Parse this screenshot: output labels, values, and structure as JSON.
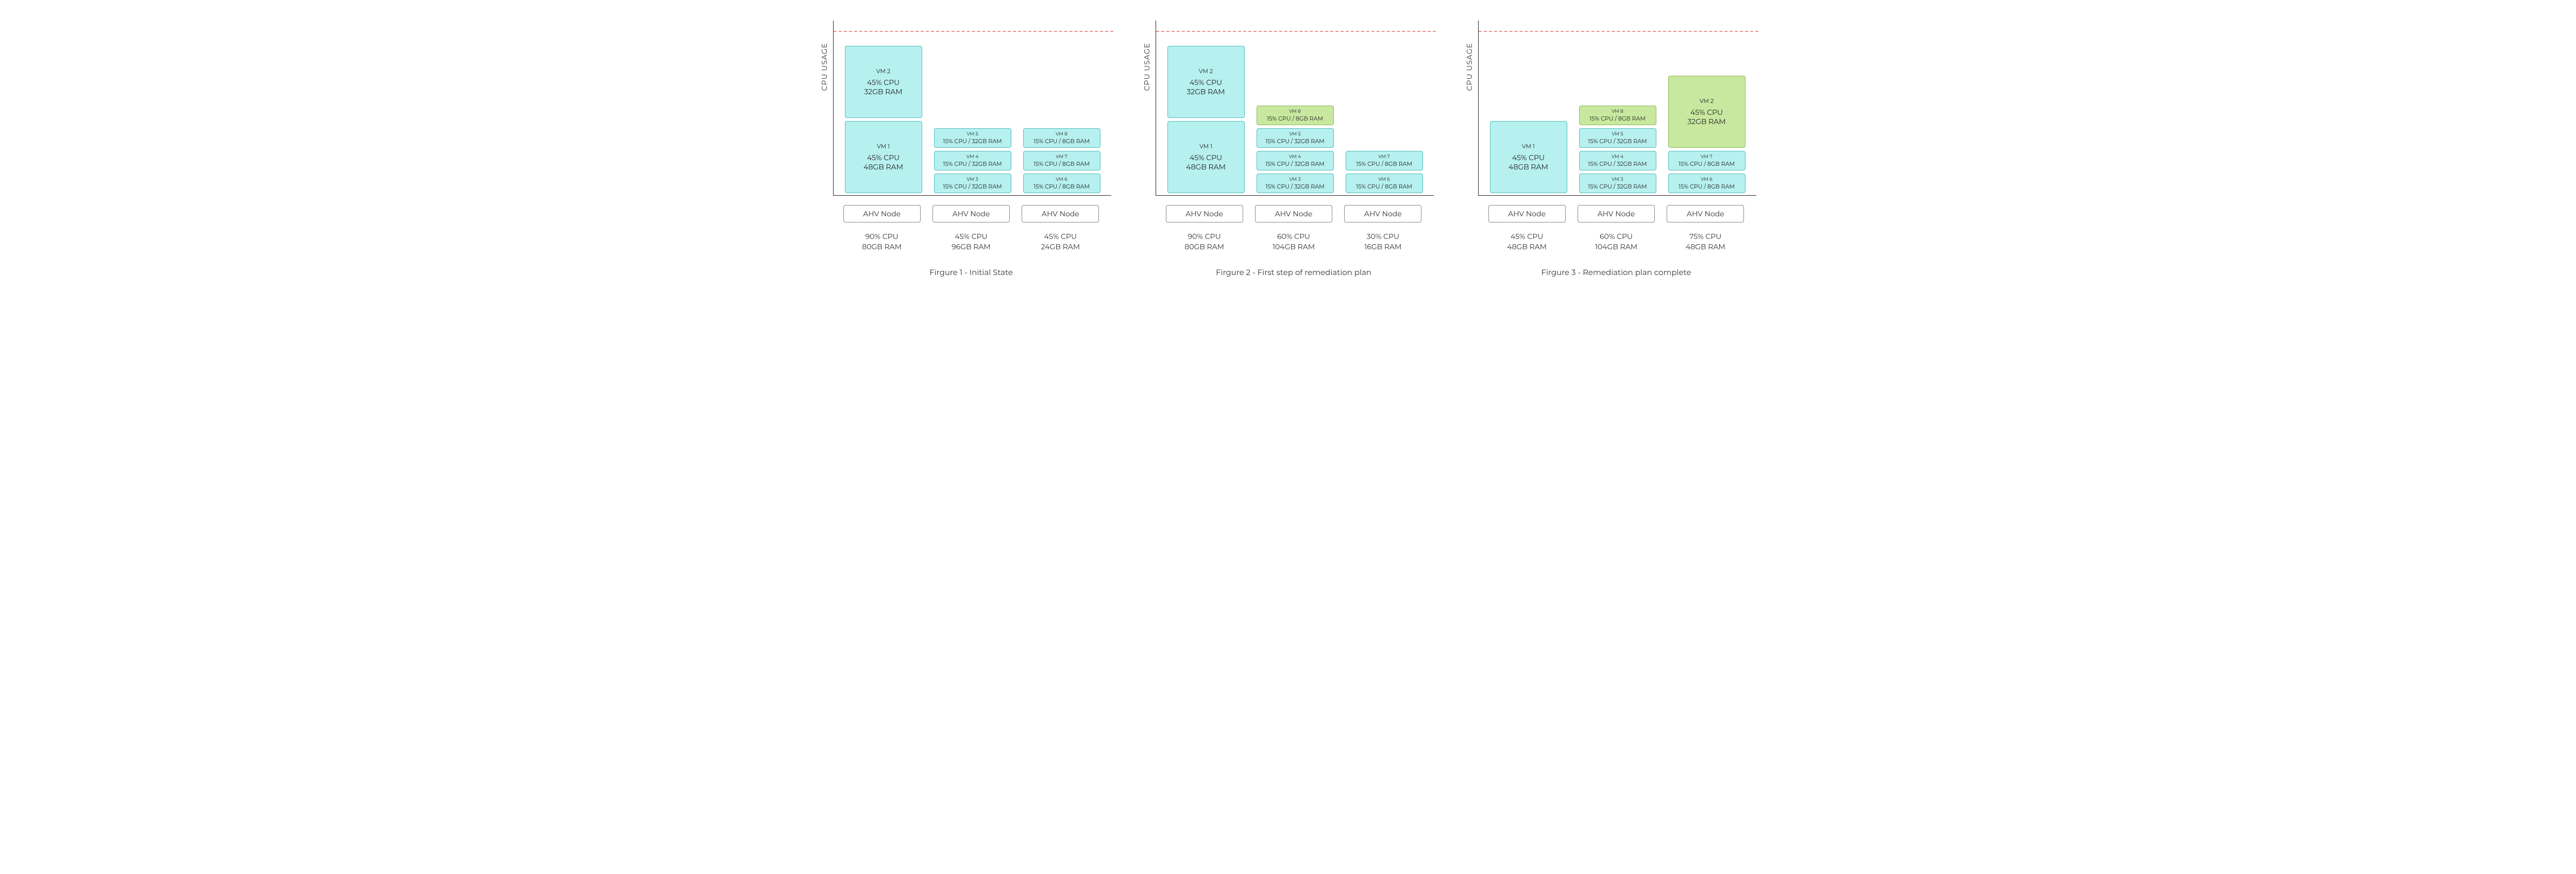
{
  "ylabel": "CPU USAGE",
  "node_label": "AHV Node",
  "figures": [
    {
      "caption": "Firgure 1 - Initial State",
      "columns": [
        {
          "stats": {
            "cpu": "90% CPU",
            "ram": "80GB RAM"
          },
          "vms": [
            {
              "size": "big",
              "color": "cyan",
              "name": "VM 1",
              "l1": "45% CPU",
              "l2": "48GB RAM"
            },
            {
              "size": "big",
              "color": "cyan",
              "name": "VM 2",
              "l1": "45% CPU",
              "l2": "32GB RAM"
            }
          ]
        },
        {
          "stats": {
            "cpu": "45% CPU",
            "ram": "96GB RAM"
          },
          "vms": [
            {
              "size": "small",
              "color": "cyan",
              "name": "VM 3",
              "l1": "15% CPU / 32GB RAM"
            },
            {
              "size": "small",
              "color": "cyan",
              "name": "VM 4",
              "l1": "15% CPU / 32GB RAM"
            },
            {
              "size": "small",
              "color": "cyan",
              "name": "VM 5",
              "l1": "15% CPU / 32GB RAM"
            }
          ]
        },
        {
          "stats": {
            "cpu": "45% CPU",
            "ram": "24GB RAM"
          },
          "vms": [
            {
              "size": "small",
              "color": "cyan",
              "name": "VM 6",
              "l1": "15% CPU / 8GB RAM"
            },
            {
              "size": "small",
              "color": "cyan",
              "name": "VM 7",
              "l1": "15% CPU / 8GB RAM"
            },
            {
              "size": "small",
              "color": "cyan",
              "name": "VM 8",
              "l1": "15% CPU / 8GB RAM"
            }
          ]
        }
      ]
    },
    {
      "caption": "Firgure 2 - First step of remediation plan",
      "columns": [
        {
          "stats": {
            "cpu": "90% CPU",
            "ram": "80GB RAM"
          },
          "vms": [
            {
              "size": "big",
              "color": "cyan",
              "name": "VM 1",
              "l1": "45% CPU",
              "l2": "48GB RAM"
            },
            {
              "size": "big",
              "color": "cyan",
              "name": "VM 2",
              "l1": "45% CPU",
              "l2": "32GB RAM"
            }
          ]
        },
        {
          "stats": {
            "cpu": "60% CPU",
            "ram": "104GB RAM"
          },
          "vms": [
            {
              "size": "small",
              "color": "cyan",
              "name": "VM 3",
              "l1": "15% CPU / 32GB RAM"
            },
            {
              "size": "small",
              "color": "cyan",
              "name": "VM 4",
              "l1": "15% CPU / 32GB RAM"
            },
            {
              "size": "small",
              "color": "cyan",
              "name": "VM 5",
              "l1": "15% CPU / 32GB RAM"
            },
            {
              "size": "small",
              "color": "green",
              "name": "VM 8",
              "l1": "15% CPU / 8GB RAM"
            }
          ]
        },
        {
          "stats": {
            "cpu": "30% CPU",
            "ram": "16GB RAM"
          },
          "vms": [
            {
              "size": "small",
              "color": "cyan",
              "name": "VM 6",
              "l1": "15% CPU / 8GB RAM"
            },
            {
              "size": "small",
              "color": "cyan",
              "name": "VM 7",
              "l1": "15% CPU / 8GB RAM"
            }
          ]
        }
      ]
    },
    {
      "caption": "Firgure 3 - Remediation plan complete",
      "columns": [
        {
          "stats": {
            "cpu": "45% CPU",
            "ram": "48GB RAM"
          },
          "vms": [
            {
              "size": "big",
              "color": "cyan",
              "name": "VM 1",
              "l1": "45% CPU",
              "l2": "48GB RAM"
            }
          ]
        },
        {
          "stats": {
            "cpu": "60% CPU",
            "ram": "104GB RAM"
          },
          "vms": [
            {
              "size": "small",
              "color": "cyan",
              "name": "VM 3",
              "l1": "15% CPU / 32GB RAM"
            },
            {
              "size": "small",
              "color": "cyan",
              "name": "VM 4",
              "l1": "15% CPU / 32GB RAM"
            },
            {
              "size": "small",
              "color": "cyan",
              "name": "VM 5",
              "l1": "15% CPU / 32GB RAM"
            },
            {
              "size": "small",
              "color": "green",
              "name": "VM 8",
              "l1": "15% CPU / 8GB RAM"
            }
          ]
        },
        {
          "stats": {
            "cpu": "75% CPU",
            "ram": "48GB RAM"
          },
          "vms": [
            {
              "size": "small",
              "color": "cyan",
              "name": "VM 6",
              "l1": "15% CPU / 8GB RAM"
            },
            {
              "size": "small",
              "color": "cyan",
              "name": "VM 7",
              "l1": "15% CPU / 8GB RAM"
            },
            {
              "size": "big",
              "color": "green",
              "name": "VM 2",
              "l1": "45% CPU",
              "l2": "32GB RAM"
            }
          ]
        }
      ]
    }
  ],
  "chart_data": {
    "type": "bar",
    "description": "Three stacked-bar style diagrams showing VM placement across 3 AHV nodes during a remediation plan. Height corresponds to CPU usage; dashed red line indicates threshold (~90%).",
    "threshold_pct": 90,
    "figures": [
      {
        "title": "Firgure 1 - Initial State",
        "nodes": [
          {
            "label": "AHV Node",
            "cpu_pct": 90,
            "ram_gb": 80,
            "vms": [
              {
                "name": "VM 1",
                "cpu_pct": 45,
                "ram_gb": 48
              },
              {
                "name": "VM 2",
                "cpu_pct": 45,
                "ram_gb": 32
              }
            ]
          },
          {
            "label": "AHV Node",
            "cpu_pct": 45,
            "ram_gb": 96,
            "vms": [
              {
                "name": "VM 3",
                "cpu_pct": 15,
                "ram_gb": 32
              },
              {
                "name": "VM 4",
                "cpu_pct": 15,
                "ram_gb": 32
              },
              {
                "name": "VM 5",
                "cpu_pct": 15,
                "ram_gb": 32
              }
            ]
          },
          {
            "label": "AHV Node",
            "cpu_pct": 45,
            "ram_gb": 24,
            "vms": [
              {
                "name": "VM 6",
                "cpu_pct": 15,
                "ram_gb": 8
              },
              {
                "name": "VM 7",
                "cpu_pct": 15,
                "ram_gb": 8
              },
              {
                "name": "VM 8",
                "cpu_pct": 15,
                "ram_gb": 8
              }
            ]
          }
        ]
      },
      {
        "title": "Firgure 2 - First step of remediation plan",
        "nodes": [
          {
            "label": "AHV Node",
            "cpu_pct": 90,
            "ram_gb": 80,
            "vms": [
              {
                "name": "VM 1",
                "cpu_pct": 45,
                "ram_gb": 48
              },
              {
                "name": "VM 2",
                "cpu_pct": 45,
                "ram_gb": 32
              }
            ]
          },
          {
            "label": "AHV Node",
            "cpu_pct": 60,
            "ram_gb": 104,
            "vms": [
              {
                "name": "VM 3",
                "cpu_pct": 15,
                "ram_gb": 32
              },
              {
                "name": "VM 4",
                "cpu_pct": 15,
                "ram_gb": 32
              },
              {
                "name": "VM 5",
                "cpu_pct": 15,
                "ram_gb": 32
              },
              {
                "name": "VM 8",
                "cpu_pct": 15,
                "ram_gb": 8,
                "moved": true
              }
            ]
          },
          {
            "label": "AHV Node",
            "cpu_pct": 30,
            "ram_gb": 16,
            "vms": [
              {
                "name": "VM 6",
                "cpu_pct": 15,
                "ram_gb": 8
              },
              {
                "name": "VM 7",
                "cpu_pct": 15,
                "ram_gb": 8
              }
            ]
          }
        ]
      },
      {
        "title": "Firgure 3 - Remediation plan complete",
        "nodes": [
          {
            "label": "AHV Node",
            "cpu_pct": 45,
            "ram_gb": 48,
            "vms": [
              {
                "name": "VM 1",
                "cpu_pct": 45,
                "ram_gb": 48
              }
            ]
          },
          {
            "label": "AHV Node",
            "cpu_pct": 60,
            "ram_gb": 104,
            "vms": [
              {
                "name": "VM 3",
                "cpu_pct": 15,
                "ram_gb": 32
              },
              {
                "name": "VM 4",
                "cpu_pct": 15,
                "ram_gb": 32
              },
              {
                "name": "VM 5",
                "cpu_pct": 15,
                "ram_gb": 32
              },
              {
                "name": "VM 8",
                "cpu_pct": 15,
                "ram_gb": 8,
                "moved": true
              }
            ]
          },
          {
            "label": "AHV Node",
            "cpu_pct": 75,
            "ram_gb": 48,
            "vms": [
              {
                "name": "VM 6",
                "cpu_pct": 15,
                "ram_gb": 8
              },
              {
                "name": "VM 7",
                "cpu_pct": 15,
                "ram_gb": 8
              },
              {
                "name": "VM 2",
                "cpu_pct": 45,
                "ram_gb": 32,
                "moved": true
              }
            ]
          }
        ]
      }
    ]
  }
}
